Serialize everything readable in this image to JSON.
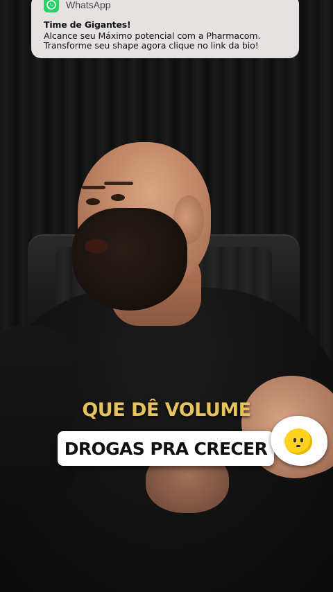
{
  "notification": {
    "app_name": "WhatsApp",
    "title": "Time de Gigantes!",
    "body_line1": "Alcance seu Máximo potencial com a Pharmacom.",
    "body_line2": "Transforme seu shape agora clique no link da bio!",
    "icon": "whatsapp-icon",
    "icon_color": "#25d366",
    "background_color": "#e6e2e2"
  },
  "captions": {
    "highlight_text": "QUE DÊ VOLUME",
    "highlight_color": "#e8c25a",
    "boxed_text": "DROGAS PRA CRECER",
    "boxed_background": "#ffffff"
  },
  "sticker": {
    "icon": "fried-egg-icon",
    "yolk_color": "#ffd21f"
  }
}
